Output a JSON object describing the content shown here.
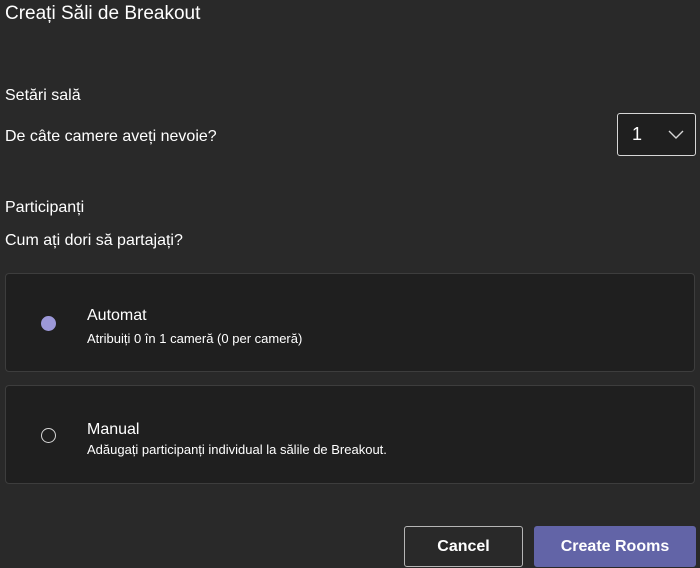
{
  "dialog": {
    "title": "Creați Săli de Breakout"
  },
  "room_settings": {
    "label": "Setări sală",
    "question": "De câte camere aveți nevoie?",
    "room_count": "1"
  },
  "participants": {
    "label": "Participanți",
    "question": "Cum ați dori să partajați?",
    "options": [
      {
        "title": "Automat",
        "description": "Atribuiți 0 în 1 cameră (0 per cameră)",
        "selected": true
      },
      {
        "title": "Manual",
        "description": "Adăugați participanți individual la sălile de Breakout.",
        "selected": false
      }
    ]
  },
  "footer": {
    "cancel_label": "Cancel",
    "create_label": "Create Rooms"
  },
  "colors": {
    "background": "#292929",
    "card": "#1f1f1f",
    "accent": "#6264a7",
    "radio_selected": "#9c98d8"
  },
  "icons": {
    "dropdown": "chevron-down-icon"
  }
}
